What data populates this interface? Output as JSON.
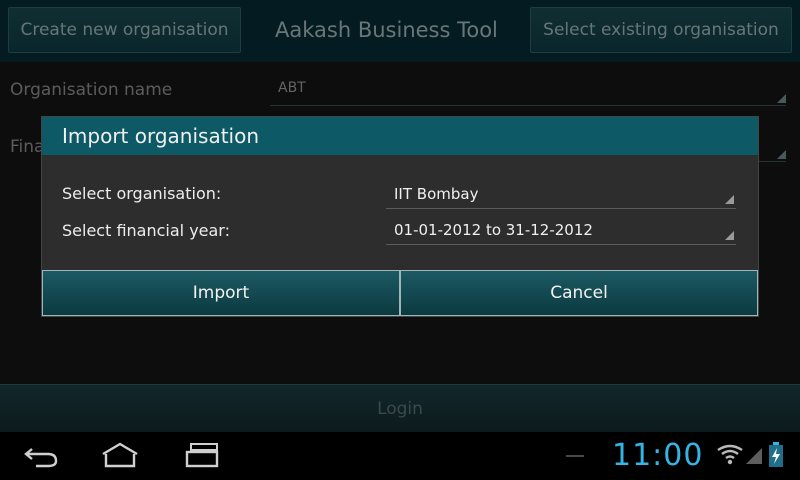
{
  "topbar": {
    "create_button_label": "Create new organisation",
    "app_title": "Aakash Business Tool",
    "select_button_label": "Select existing organisation"
  },
  "form": {
    "org_name_label": "Organisation name",
    "org_name_value": "ABT",
    "fin_label_partial": "Fina"
  },
  "login_label": "Login",
  "dialog": {
    "title": "Import organisation",
    "select_org_label": "Select organisation:",
    "select_org_value": "IIT Bombay",
    "select_year_label": "Select financial year:",
    "select_year_value": "01-01-2012 to 31-12-2012",
    "import_label": "Import",
    "cancel_label": "Cancel"
  },
  "navbar": {
    "icons": [
      "back-icon",
      "home-icon",
      "recent-apps-icon"
    ]
  },
  "status": {
    "time": "11:00",
    "icons": [
      "wifi-icon",
      "signal-icon",
      "battery-charging-icon"
    ]
  },
  "colors": {
    "accent": "#0d5a66",
    "clock": "#34b5e5",
    "topbar": "#072c33"
  }
}
